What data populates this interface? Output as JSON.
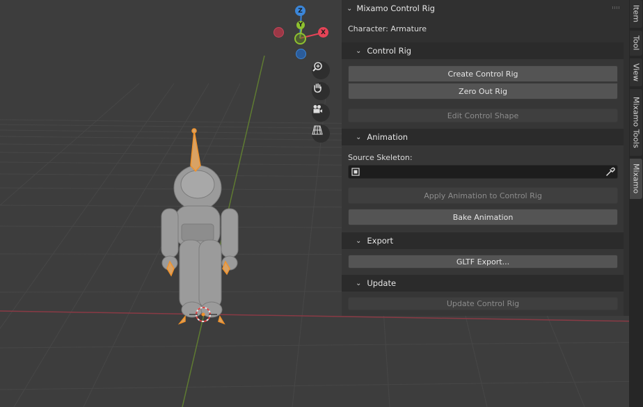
{
  "gizmo": {
    "z_label": "Z",
    "y_label": "Y",
    "x_label": "X"
  },
  "panel": {
    "title": "Mixamo Control Rig",
    "character_label": "Character: Armature",
    "control_rig": {
      "header": "Control Rig",
      "create_button": "Create Control Rig",
      "zero_out_button": "Zero Out Rig",
      "edit_shape_button": "Edit Control Shape"
    },
    "animation": {
      "header": "Animation",
      "source_label": "Source Skeleton:",
      "source_value": "",
      "apply_button": "Apply Animation to Control Rig",
      "bake_button": "Bake Animation"
    },
    "export": {
      "header": "Export",
      "gltf_button": "GLTF Export..."
    },
    "update": {
      "header": "Update",
      "update_button": "Update Control Rig"
    }
  },
  "tabs": [
    "Item",
    "Tool",
    "View",
    "Mixamo Tools",
    "Mixamo"
  ],
  "colors": {
    "x_axis": "#e64457",
    "y_axis": "#8ec12f",
    "z_axis": "#3b86d9",
    "selection": "#f0922b"
  }
}
